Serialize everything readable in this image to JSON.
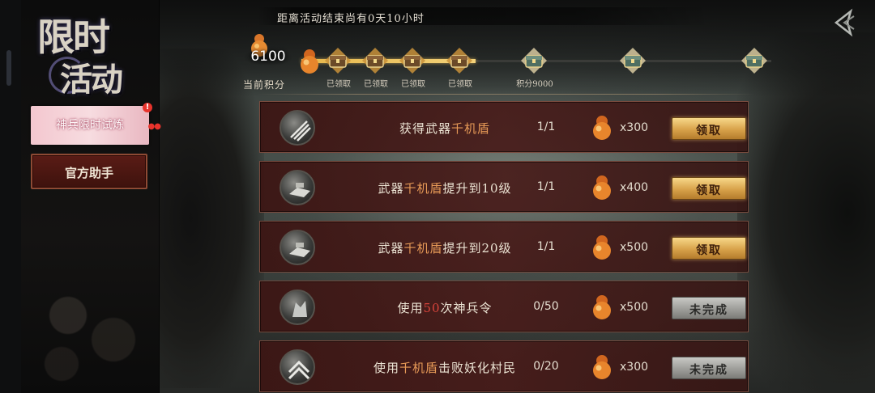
{
  "sidebar": {
    "logo_line1": "限时",
    "logo_line2": "活动",
    "banner_label": "神兵限时试炼",
    "banner_badge": "!",
    "helper_button": "官方助手"
  },
  "header": {
    "timer_text": "距离活动结束尚有0天10小时",
    "back_icon": "back-arrow-icon"
  },
  "progress": {
    "score": "6100",
    "score_label": "当前积分",
    "fill_fraction": 0.37,
    "milestones": [
      {
        "label": "已领取",
        "state": "claimed"
      },
      {
        "label": "已领取",
        "state": "claimed"
      },
      {
        "label": "已领取",
        "state": "claimed"
      },
      {
        "label": "已领取",
        "state": "claimed"
      },
      {
        "label": "积分9000",
        "state": "locked"
      },
      {
        "label": "",
        "state": "locked"
      },
      {
        "label": "",
        "state": "locked"
      }
    ]
  },
  "tasks": [
    {
      "pre": "获得武器",
      "hl": "千机盾",
      "post": "",
      "hl_style": "orange",
      "progress": "1/1",
      "reward": "x300",
      "button": "领取",
      "state": "claim"
    },
    {
      "pre": "武器",
      "hl": "千机盾",
      "post": "提升到10级",
      "hl_style": "orange",
      "progress": "1/1",
      "reward": "x400",
      "button": "领取",
      "state": "claim"
    },
    {
      "pre": "武器",
      "hl": "千机盾",
      "post": "提升到20级",
      "hl_style": "orange",
      "progress": "1/1",
      "reward": "x500",
      "button": "领取",
      "state": "claim"
    },
    {
      "pre": "使用",
      "hl": "50",
      "post": "次神兵令",
      "hl_style": "red",
      "progress": "0/50",
      "reward": "x500",
      "button": "未完成",
      "state": "todo"
    },
    {
      "pre": "使用",
      "hl": "千机盾",
      "post": "击败妖化村民",
      "hl_style": "orange",
      "progress": "0/20",
      "reward": "x300",
      "button": "未完成",
      "state": "todo"
    }
  ],
  "colors": {
    "accent_gold": "#e6b74b",
    "highlight_orange": "#e79a57",
    "highlight_red": "#d8433a",
    "row_bg": "#481c1a"
  }
}
